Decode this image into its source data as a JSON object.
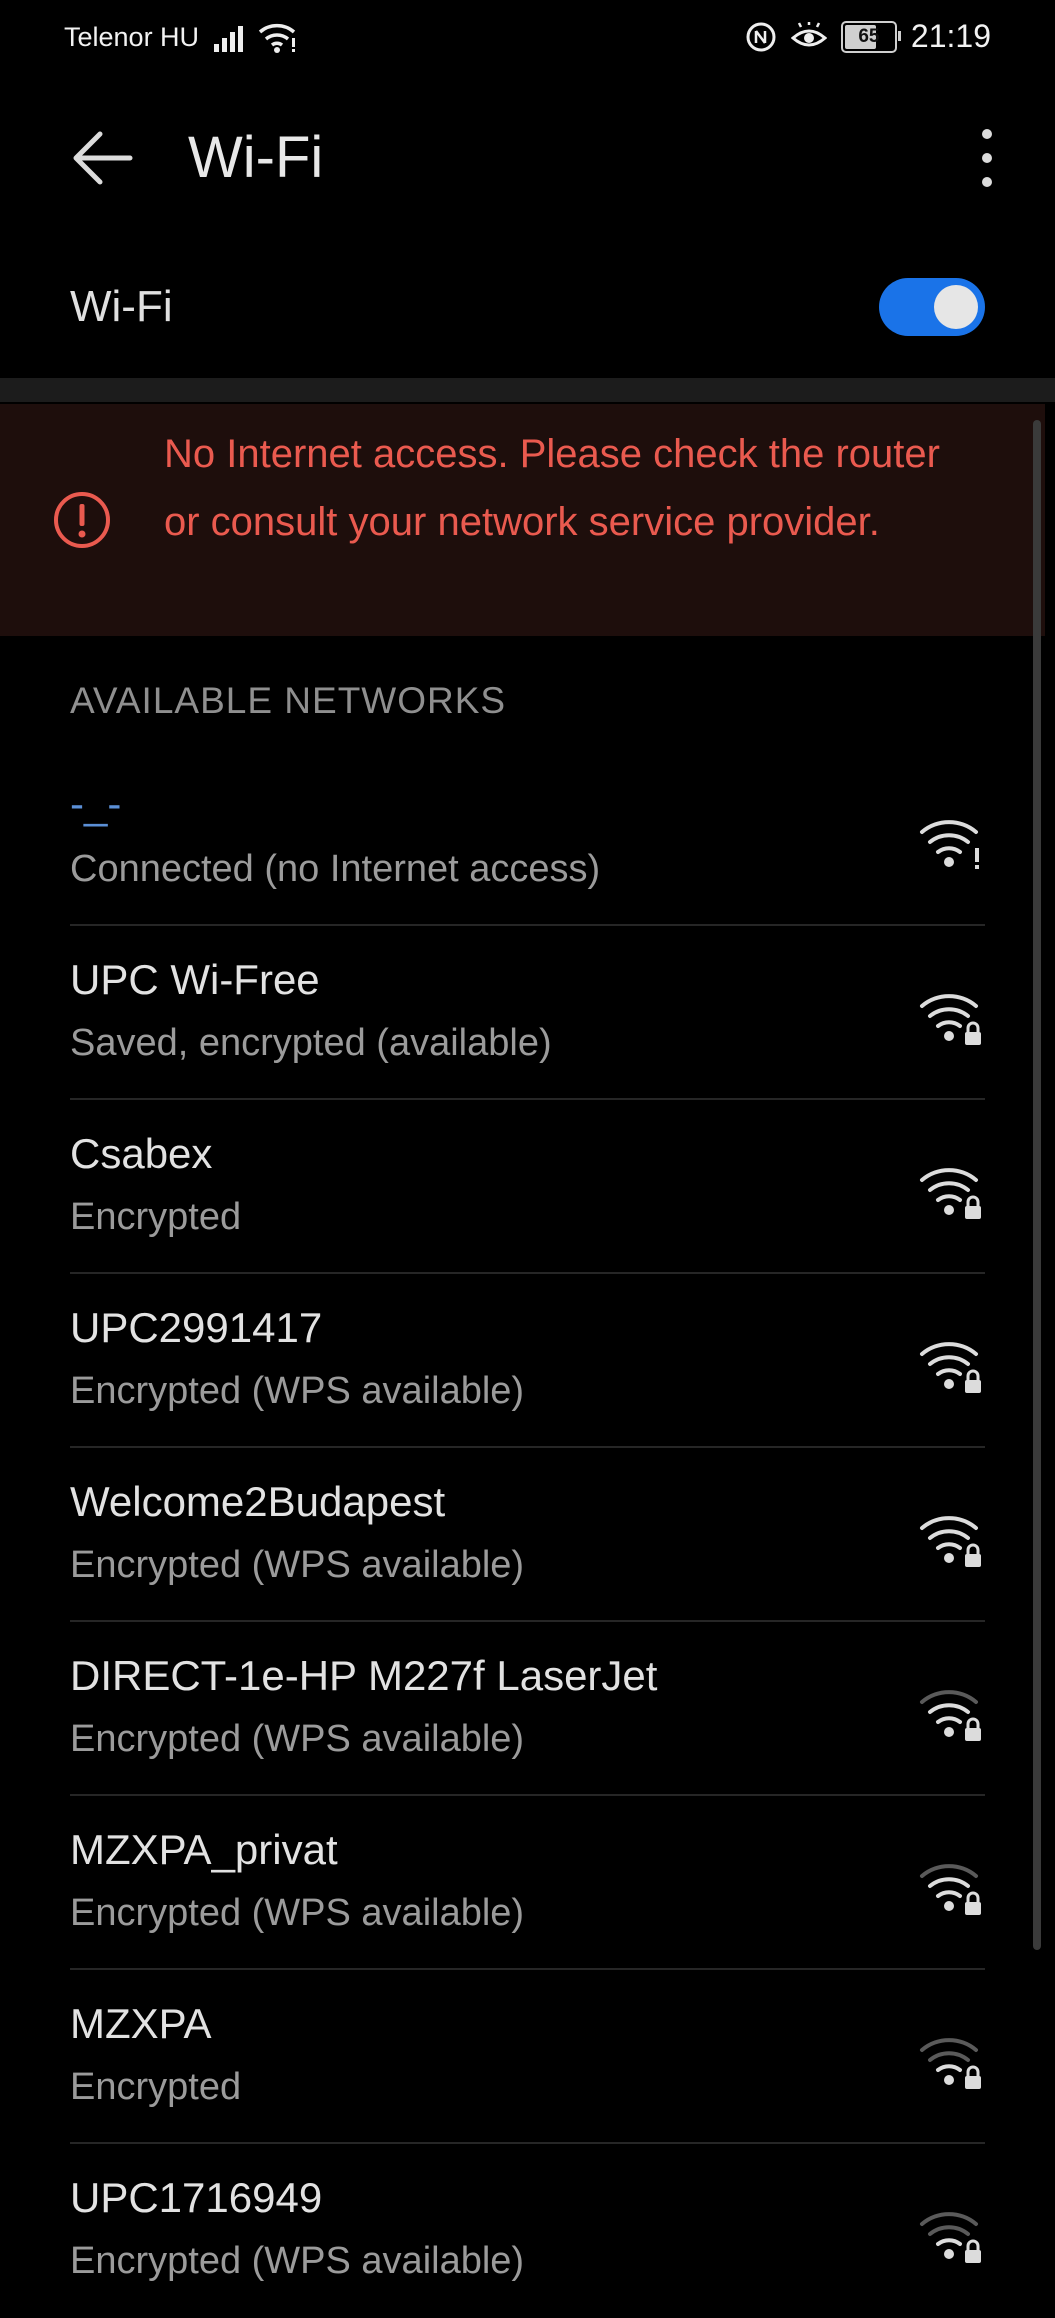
{
  "status_bar": {
    "carrier": "Telenor HU",
    "battery": "65",
    "time": "21:19"
  },
  "app_bar": {
    "title": "Wi-Fi"
  },
  "wifi_toggle": {
    "label": "Wi-Fi",
    "on": true,
    "accent_color": "#1a73e8"
  },
  "alert": {
    "message": "No Internet access. Please check the router or consult your network service provider.",
    "color": "#ea5a4f"
  },
  "section_header": "AVAILABLE NETWORKS",
  "networks": [
    {
      "name": "-_-",
      "status": "Connected (no Internet access)",
      "icon": "wifi-no-internet-icon"
    },
    {
      "name": "UPC Wi-Free",
      "status": "Saved, encrypted (available)",
      "icon": "wifi-lock-icon"
    },
    {
      "name": "Csabex",
      "status": "Encrypted",
      "icon": "wifi-lock-icon"
    },
    {
      "name": "UPC2991417",
      "status": "Encrypted (WPS available)",
      "icon": "wifi-lock-icon"
    },
    {
      "name": "Welcome2Budapest",
      "status": "Encrypted (WPS available)",
      "icon": "wifi-lock-icon"
    },
    {
      "name": "DIRECT-1e-HP M227f LaserJet",
      "status": "Encrypted (WPS available)",
      "icon": "wifi-lock-icon"
    },
    {
      "name": "MZXPA_privat",
      "status": "Encrypted (WPS available)",
      "icon": "wifi-lock-icon"
    },
    {
      "name": "MZXPA",
      "status": "Encrypted",
      "icon": "wifi-lock-icon"
    },
    {
      "name": "UPC1716949",
      "status": "Encrypted (WPS available)",
      "icon": "wifi-lock-icon"
    }
  ]
}
